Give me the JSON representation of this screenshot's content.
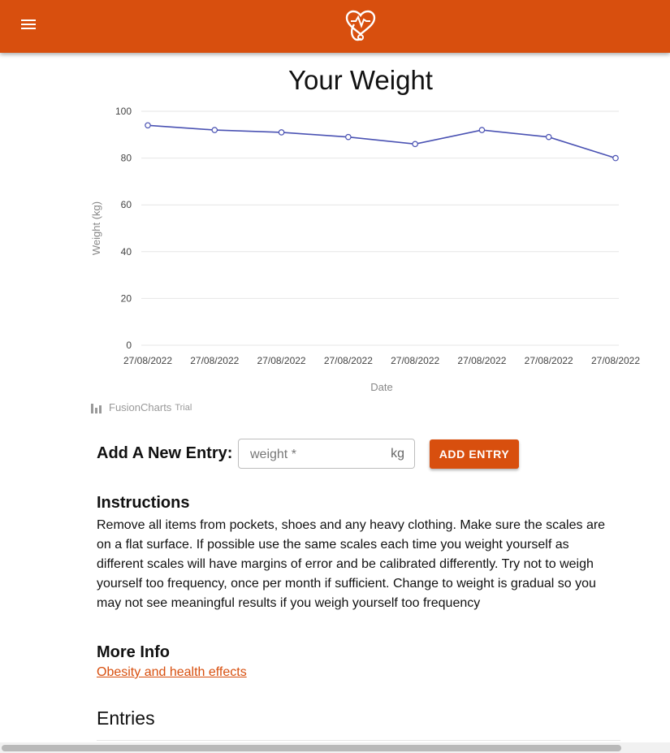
{
  "header": {
    "menu_icon": "hamburger-menu-icon",
    "logo_icon": "heart-stethoscope-icon",
    "background": "#d84f0e"
  },
  "chart": {
    "title": "Your Weight",
    "watermark": {
      "brand": "FusionCharts",
      "suffix": "Trial"
    }
  },
  "chart_data": {
    "type": "line",
    "title": "Your Weight",
    "xlabel": "Date",
    "ylabel": "Weight (kg)",
    "ylim": [
      0,
      100
    ],
    "yticks": [
      0,
      20,
      40,
      60,
      80,
      100
    ],
    "grid": true,
    "line_color": "#4a52b3",
    "categories": [
      "27/08/2022",
      "27/08/2022",
      "27/08/2022",
      "27/08/2022",
      "27/08/2022",
      "27/08/2022",
      "27/08/2022",
      "27/08/2022"
    ],
    "values": [
      94,
      92,
      91,
      89,
      86,
      92,
      89,
      80
    ]
  },
  "entry_form": {
    "label": "Add A New Entry:",
    "placeholder": "weight *",
    "unit": "kg",
    "button_label": "ADD ENTRY"
  },
  "instructions": {
    "heading": "Instructions",
    "body": "Remove all items from pockets, shoes and any heavy clothing. Make sure the scales are on a flat surface. If possible use the same scales each time you weight yourself as different scales will have margins of error and be calibrated differently. Try not to weigh yourself too frequency, once per month if sufficient. Change to weight is gradual so you may not see meaningful results if you weigh yourself too frequency"
  },
  "more_info": {
    "heading": "More Info",
    "link_text": "Obesity and health effects"
  },
  "entries": {
    "heading": "Entries"
  }
}
